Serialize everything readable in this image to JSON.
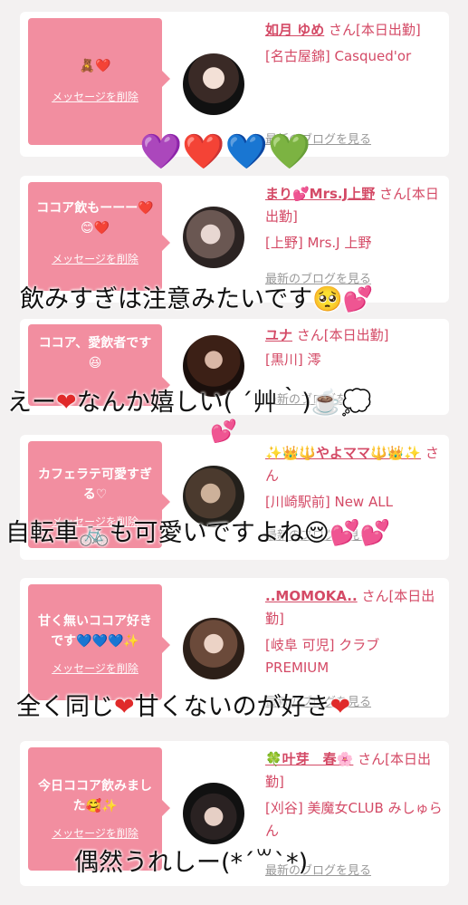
{
  "cards": [
    {
      "message": "🧸❤️",
      "delete_label": "メッセージを削除",
      "name": "如月 ゆめ",
      "status": "さん[本日出勤]",
      "shop": "[名古屋錦] Casqued'or",
      "blog_label": "最新のブログを見る"
    },
    {
      "message": "ココア飲もーーー❤️😊❤️",
      "delete_label": "メッセージを削除",
      "name": "まり💕Mrs.J上野",
      "status": "さん[本日出勤]",
      "shop": "[上野] Mrs.J 上野",
      "blog_label": "最新のブログを見る"
    },
    {
      "message": "ココア、愛飲者です😆",
      "delete_label": "メッセージを削除",
      "name": "ユナ",
      "status": "さん[本日出勤]",
      "shop": "[黒川] 澪",
      "blog_label": "最新のブログを見る"
    },
    {
      "message": "カフェラテ可愛すぎる♡",
      "delete_label": "メッセージを削除",
      "name": "✨👑🔱やよママ🔱👑✨",
      "status": "さん",
      "shop": "[川崎駅前] New ALL",
      "blog_label": "最新のブログを見る"
    },
    {
      "message": "甘く無いココア好きです💙💙💙✨",
      "delete_label": "メッセージを削除",
      "name": "..MOMOKA..",
      "status": "さん[本日出勤]",
      "shop": "[岐阜 可児] クラブ PREMIUM",
      "blog_label": "最新のブログを見る"
    },
    {
      "message": "今日ココア飲みました🥰✨",
      "delete_label": "メッセージを削除",
      "name": "🍀叶芽　春🌸",
      "status": "さん[本日出勤]",
      "shop": "[刈谷] 美魔女CLUB みしゅらん",
      "blog_label": "最新のブログを見る"
    }
  ],
  "overlays": {
    "hearts_row": "💜❤️💙💚",
    "caption1": "飲みすぎは注意みたいです🥺💕",
    "caption2_a": "えー",
    "caption2_b": "なんか嬉しい( ´艸｀)☕️💭",
    "caption2_c": "💕",
    "caption3": "自転車🚲も可愛いですよね😌💕💕",
    "caption4_a": "全く同じ",
    "caption4_b": "甘くないのが好き",
    "caption5": "偶然うれしー(*´꒳`*)",
    "heart_glyph": "❤"
  },
  "colors": {
    "accent_pink": "#f28ea0",
    "name_pink": "#d44a66",
    "background": "#f3f1f1"
  }
}
